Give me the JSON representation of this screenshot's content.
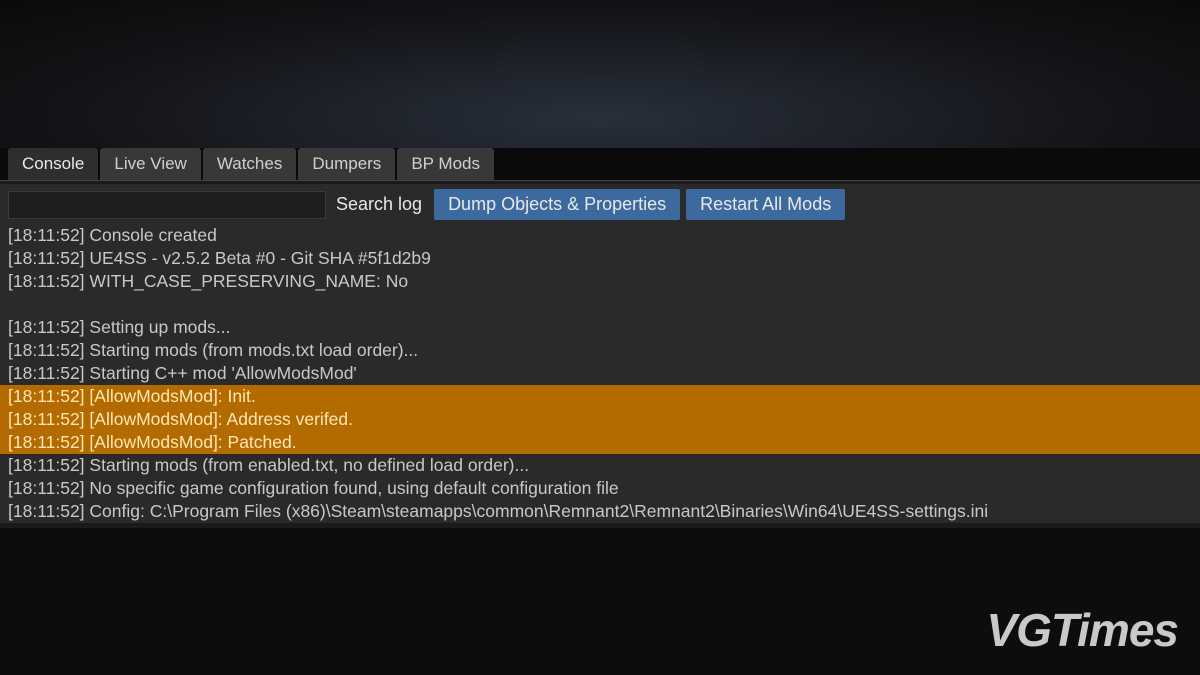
{
  "tabs": [
    {
      "label": "Console",
      "active": true
    },
    {
      "label": "Live View",
      "active": false
    },
    {
      "label": "Watches",
      "active": false
    },
    {
      "label": "Dumpers",
      "active": false
    },
    {
      "label": "BP Mods",
      "active": false
    }
  ],
  "toolbar": {
    "search_label": "Search log",
    "dump_button": "Dump Objects & Properties",
    "restart_button": "Restart All Mods"
  },
  "log": [
    {
      "ts": "[18:11:52]",
      "msg": "Console created",
      "hl": false
    },
    {
      "ts": "[18:11:52]",
      "msg": "UE4SS - v2.5.2 Beta #0 - Git SHA #5f1d2b9",
      "hl": false
    },
    {
      "ts": "[18:11:52]",
      "msg": "WITH_CASE_PRESERVING_NAME: No",
      "hl": false
    },
    {
      "gap": true
    },
    {
      "ts": "[18:11:52]",
      "msg": "Setting up mods...",
      "hl": false
    },
    {
      "ts": "[18:11:52]",
      "msg": "Starting mods (from mods.txt load order)...",
      "hl": false
    },
    {
      "ts": "[18:11:52]",
      "msg": "Starting C++ mod 'AllowModsMod'",
      "hl": false
    },
    {
      "ts": "[18:11:52]",
      "msg": "[AllowModsMod]: Init.",
      "hl": true
    },
    {
      "ts": "[18:11:52]",
      "msg": "[AllowModsMod]: Address verifed.",
      "hl": true
    },
    {
      "ts": "[18:11:52]",
      "msg": "[AllowModsMod]: Patched.",
      "hl": true
    },
    {
      "ts": "[18:11:52]",
      "msg": "Starting mods (from enabled.txt, no defined load order)...",
      "hl": false
    },
    {
      "ts": "[18:11:52]",
      "msg": "No specific game configuration found, using default configuration file",
      "hl": false
    },
    {
      "ts": "[18:11:52]",
      "msg": "Config: C:\\Program Files (x86)\\Steam\\steamapps\\common\\Remnant2\\Remnant2\\Binaries\\Win64\\UE4SS-settings.ini",
      "hl": false
    }
  ],
  "watermark": "VGTimes"
}
